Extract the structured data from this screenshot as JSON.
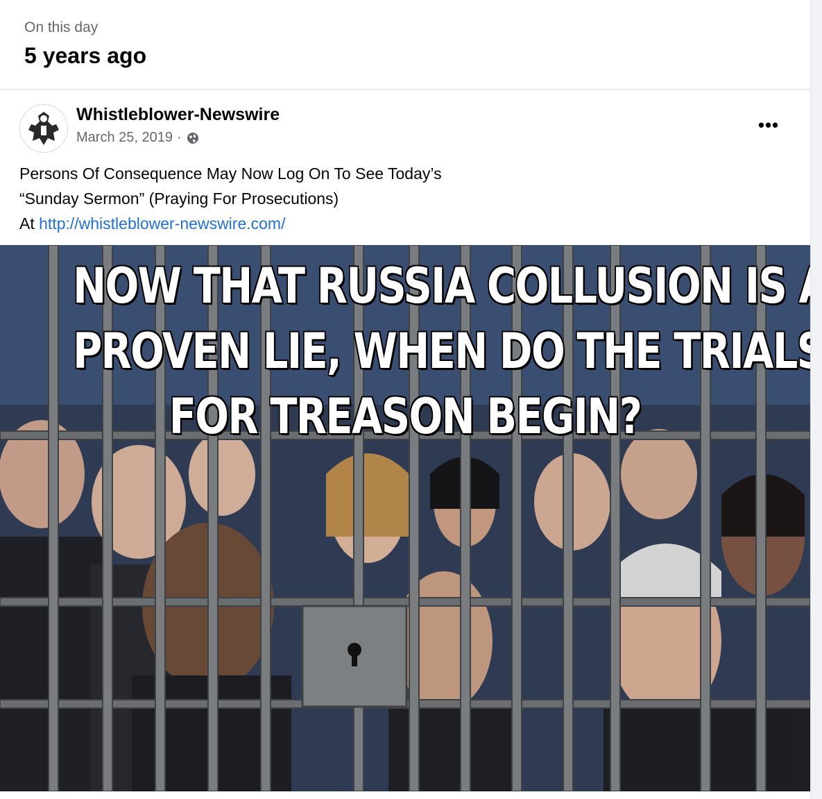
{
  "memory": {
    "label": "On this day",
    "title": "5 years ago"
  },
  "post": {
    "page_name": "Whistleblower-Newswire",
    "date": "March 25, 2019",
    "separator": "·",
    "privacy_icon": "globe-icon",
    "more_label": "•••",
    "text_line_1": "Persons Of Consequence May Now Log On To See Today’s",
    "text_line_2": "“Sunday Sermon” (Praying For Prosecutions)",
    "text_line_3_prefix": "At ",
    "link": "http://whistleblower-newswire.com/"
  },
  "image": {
    "headline_line_1": "NOW THAT RUSSIA COLLUSION IS A",
    "headline_line_2": "PROVEN LIE, WHEN DO THE TRIALS",
    "headline_line_3": "FOR TREASON BEGIN?"
  },
  "colors": {
    "link": "#216fdb",
    "secondary_text": "#65676b",
    "bars": "#6b6e70"
  }
}
